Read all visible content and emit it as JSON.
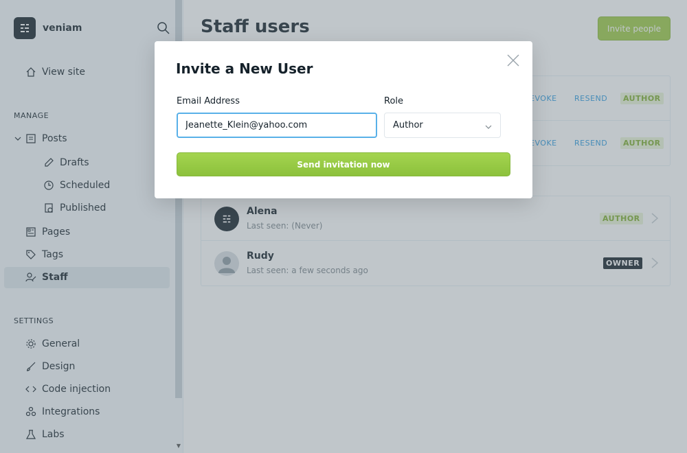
{
  "brand": {
    "name": "veniam"
  },
  "sidebar": {
    "view_site": "View site",
    "manage_title": "MANAGE",
    "posts": "Posts",
    "drafts": "Drafts",
    "scheduled": "Scheduled",
    "published": "Published",
    "pages": "Pages",
    "tags": "Tags",
    "staff": "Staff",
    "settings_title": "SETTINGS",
    "general": "General",
    "design": "Design",
    "code_injection": "Code injection",
    "integrations": "Integrations",
    "labs": "Labs"
  },
  "main": {
    "title": "Staff users",
    "invite_button": "Invite people",
    "invited": [
      {
        "revoke": "EVOKE",
        "resend": "RESEND",
        "role": "AUTHOR"
      },
      {
        "revoke": "EVOKE",
        "resend": "RESEND",
        "role": "AUTHOR"
      }
    ],
    "users": [
      {
        "name": "Alena",
        "last_seen": "Last seen: (Never)",
        "role": "AUTHOR"
      },
      {
        "name": "Rudy",
        "last_seen": "Last seen: a few seconds ago",
        "role": "OWNER"
      }
    ]
  },
  "modal": {
    "title": "Invite a New User",
    "email_label": "Email Address",
    "email_value": "Jeanette_Klein@yahoo.com",
    "role_label": "Role",
    "role_value": "Author",
    "send_button": "Send invitation now"
  },
  "colors": {
    "accent_green": "#9fcb45",
    "link_blue": "#2d9be0",
    "dark": "#15212a"
  }
}
